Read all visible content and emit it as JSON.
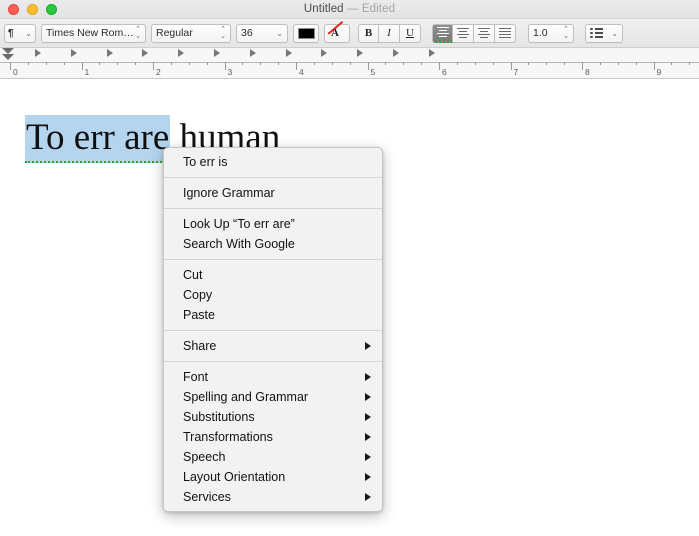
{
  "window": {
    "title": "Untitled",
    "edited_suffix": "— Edited",
    "traffic_lights": [
      "close-button",
      "minimize-button",
      "zoom-button"
    ]
  },
  "toolbar": {
    "paragraph_style": "¶",
    "font_family": "Times New Rom…",
    "font_style": "Regular",
    "font_size": "36",
    "text_color_swatch": "#000000",
    "highlight_icon": "text-color-icon",
    "bold_label": "B",
    "italic_label": "I",
    "underline_label": "U",
    "alignment": [
      "align-left",
      "align-center",
      "align-right",
      "align-justify"
    ],
    "alignment_selected": "align-left",
    "line_spacing": "1.0",
    "list_icon": "bulleted-list-icon"
  },
  "ruler": {
    "unit_numbers": [
      "0",
      "1",
      "2",
      "3",
      "4",
      "5",
      "6",
      "7",
      "8",
      "9"
    ],
    "tab_stop_count": 12,
    "left_indent_marker": "0"
  },
  "document": {
    "text_before": "",
    "selected_text": "To err are",
    "text_after": " human",
    "selection_highlight": "#b5d5ef",
    "grammar_underline": "#29a329"
  },
  "context_menu": {
    "groups": [
      {
        "items": [
          {
            "label": "To err is",
            "submenu": false
          }
        ]
      },
      {
        "items": [
          {
            "label": "Ignore Grammar",
            "submenu": false
          }
        ]
      },
      {
        "items": [
          {
            "label": "Look Up “To err are”",
            "submenu": false
          },
          {
            "label": "Search With Google",
            "submenu": false
          }
        ]
      },
      {
        "items": [
          {
            "label": "Cut",
            "submenu": false
          },
          {
            "label": "Copy",
            "submenu": false
          },
          {
            "label": "Paste",
            "submenu": false
          }
        ]
      },
      {
        "items": [
          {
            "label": "Share",
            "submenu": true
          }
        ]
      },
      {
        "items": [
          {
            "label": "Font",
            "submenu": true
          },
          {
            "label": "Spelling and Grammar",
            "submenu": true
          },
          {
            "label": "Substitutions",
            "submenu": true
          },
          {
            "label": "Transformations",
            "submenu": true
          },
          {
            "label": "Speech",
            "submenu": true
          },
          {
            "label": "Layout Orientation",
            "submenu": true
          },
          {
            "label": "Services",
            "submenu": true
          }
        ]
      }
    ]
  }
}
